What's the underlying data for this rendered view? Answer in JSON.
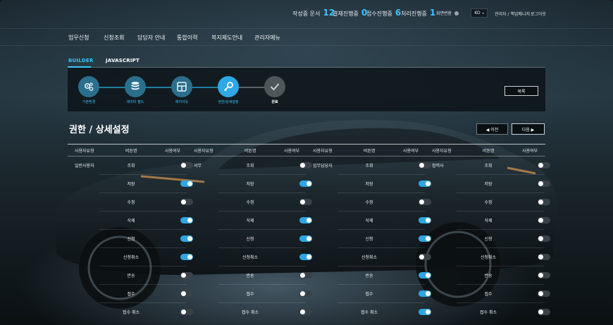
{
  "status": {
    "items": [
      {
        "label": "작성중 문서",
        "count": "12"
      },
      {
        "label": "결재진행중",
        "count": "0"
      },
      {
        "label": "접수진행중",
        "count": "6"
      },
      {
        "label": "처리진행중",
        "count": "1"
      }
    ],
    "screen_toggle_label": "화면변환",
    "lang": "KO",
    "user": "관리자 / 책임매니저",
    "logout": "로그아웃"
  },
  "nav": [
    "업무신청",
    "신청조회",
    "담당자 안내",
    "통합이력",
    "복지제도안내",
    "관리자메뉴"
  ],
  "tabs": {
    "builder": "BUILDER",
    "javascript": "JAVASCRIPT"
  },
  "steps": [
    {
      "label": "기본환경",
      "state": "done",
      "icon": "gears-icon"
    },
    {
      "label": "데이터 필드",
      "state": "done",
      "icon": "database-icon"
    },
    {
      "label": "레이아웃",
      "state": "done",
      "icon": "layout-grid-icon"
    },
    {
      "label": "권한/상세설정",
      "state": "current",
      "icon": "key-icon"
    },
    {
      "label": "완료",
      "state": "pending",
      "icon": "check-icon"
    }
  ],
  "list_button": "목록",
  "page_title": "권한 / 상세설정",
  "prev_button": "◀ 이전",
  "next_button": "다음 ▶",
  "table_headers": [
    "사용자유형",
    "버튼명",
    "사용여부"
  ],
  "groups": [
    {
      "user_type": "일반사용자",
      "rows": [
        {
          "button": "조회",
          "on": false
        },
        {
          "button": "저장",
          "on": true
        },
        {
          "button": "수정",
          "on": false
        },
        {
          "button": "삭제",
          "on": true
        },
        {
          "button": "신청",
          "on": true
        },
        {
          "button": "신청취소",
          "on": true
        },
        {
          "button": "반송",
          "on": false
        },
        {
          "button": "접수",
          "on": false
        },
        {
          "button": "접수 취소",
          "on": false
        }
      ]
    },
    {
      "user_type": "서무",
      "rows": [
        {
          "button": "조회",
          "on": false
        },
        {
          "button": "저장",
          "on": true
        },
        {
          "button": "수정",
          "on": false
        },
        {
          "button": "삭제",
          "on": true
        },
        {
          "button": "신청",
          "on": true
        },
        {
          "button": "신청취소",
          "on": true
        },
        {
          "button": "반송",
          "on": false
        },
        {
          "button": "접수",
          "on": false
        },
        {
          "button": "접수 취소",
          "on": false
        }
      ]
    },
    {
      "user_type": "업무담당자",
      "rows": [
        {
          "button": "조회",
          "on": false
        },
        {
          "button": "저장",
          "on": true
        },
        {
          "button": "수정",
          "on": false
        },
        {
          "button": "삭제",
          "on": true
        },
        {
          "button": "신청",
          "on": true
        },
        {
          "button": "신청취소",
          "on": false
        },
        {
          "button": "반송",
          "on": true
        },
        {
          "button": "접수",
          "on": true
        },
        {
          "button": "접수 취소",
          "on": true
        }
      ]
    },
    {
      "user_type": "협력사",
      "rows": [
        {
          "button": "조회",
          "on": false
        },
        {
          "button": "저장",
          "on": false
        },
        {
          "button": "수정",
          "on": false
        },
        {
          "button": "삭제",
          "on": false
        },
        {
          "button": "신청",
          "on": false
        },
        {
          "button": "신청취소",
          "on": false
        },
        {
          "button": "반송",
          "on": false
        },
        {
          "button": "접수",
          "on": false
        },
        {
          "button": "접수 취소",
          "on": false
        }
      ]
    }
  ],
  "colors": {
    "accent": "#38c4ff",
    "toggle_on": "#2ea6e3",
    "toggle_off": "#3a4247"
  }
}
